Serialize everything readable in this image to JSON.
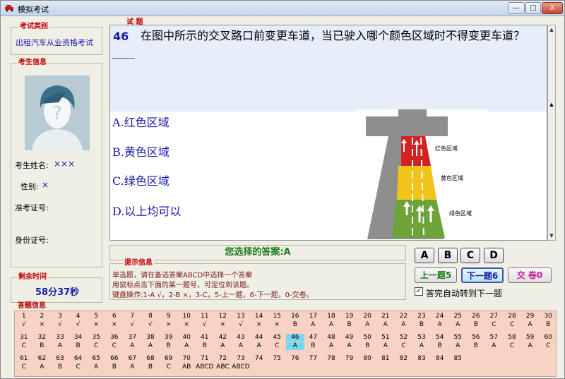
{
  "window": {
    "title": "模拟考试",
    "minimize": "—",
    "maximize": "□",
    "close": "X"
  },
  "exam_type": {
    "label": "考试类别",
    "value": "出租汽车从业资格考试"
  },
  "examinee": {
    "label": "考生信息",
    "name_label": "考生姓名:",
    "name_value": "×××",
    "gender_label": "性别:",
    "gender_value": "×",
    "ticket_label": "准考证号:",
    "id_label": "身份证号:"
  },
  "timer": {
    "label": "剩余时间",
    "value": "58分37秒"
  },
  "question": {
    "label": "试 题",
    "number": "46",
    "text": "在图中所示的交叉路口前变更车道，当已驶入哪个颜色区域时不得变更车道？____",
    "options": [
      "A.红色区域",
      "B.黄色区域",
      "C.绿色区域",
      "D.以上均可以"
    ],
    "figure_labels": [
      "红色区域",
      "黄色区域",
      "绿色区域"
    ]
  },
  "selected_answer": {
    "text": "您选择的答案:A"
  },
  "hints": {
    "label": "提示信息",
    "lines": [
      "单选题，请在备选答案ABCD中选择一个答案",
      "用鼠标点击下面的某一题号，可定位到该题。",
      "键盘操作:1-A √，2-B ×，3-C，5-上一题，6-下一题，0-交卷。"
    ]
  },
  "answer_buttons": [
    "A",
    "B",
    "C",
    "D"
  ],
  "nav": {
    "prev": "上一题5",
    "next": "下一题6",
    "submit": "交 卷0"
  },
  "auto_next": {
    "label": "答完自动转到下一题",
    "checked": "✓"
  },
  "answer_grid": {
    "label": "答题信息",
    "rows": [
      {
        "nums": [
          "1",
          "2",
          "3",
          "4",
          "5",
          "6",
          "7",
          "8",
          "9",
          "10",
          "11",
          "12",
          "13",
          "14",
          "15",
          "16",
          "17",
          "18",
          "19",
          "20",
          "21",
          "22",
          "23",
          "24",
          "25",
          "26",
          "27",
          "28",
          "29",
          "30"
        ],
        "answers": [
          "√",
          "×",
          "√",
          "√",
          "×",
          "×",
          "√",
          "√",
          "×",
          "×",
          "√",
          "×",
          "√",
          "×",
          "×",
          "B",
          "A",
          "A",
          "B",
          "A",
          "A",
          "A",
          "B",
          "A",
          "A",
          "B",
          "C",
          "C",
          "A",
          "B"
        ]
      },
      {
        "nums": [
          "31",
          "32",
          "33",
          "34",
          "35",
          "36",
          "37",
          "38",
          "39",
          "40",
          "41",
          "42",
          "43",
          "44",
          "45",
          "46",
          "47",
          "48",
          "49",
          "50",
          "51",
          "52",
          "53",
          "54",
          "55",
          "56",
          "57",
          "58",
          "59",
          "60"
        ],
        "answers": [
          "C",
          "B",
          "A",
          "B",
          "C",
          "C",
          "A",
          "A",
          "B",
          "A",
          "B",
          "A",
          "A",
          "A",
          "C",
          "A",
          "B",
          "A",
          "A",
          "B",
          "A",
          "C",
          "A",
          "B",
          "A",
          "B",
          "A",
          "C",
          "A",
          "C"
        ]
      },
      {
        "nums": [
          "61",
          "62",
          "63",
          "64",
          "65",
          "66",
          "67",
          "68",
          "69",
          "70",
          "71",
          "72",
          "73",
          "74",
          "75",
          "76",
          "77",
          "78",
          "79",
          "80",
          "81",
          "82",
          "83",
          "84",
          "85"
        ],
        "answers": [
          "C",
          "A",
          "B",
          "C",
          "A",
          "B",
          "A",
          "B",
          "C",
          "AB",
          "ABCD",
          "ABC",
          "ABCD",
          "",
          "",
          "",
          "",
          "",
          "",
          "",
          "",
          "",
          "",
          "",
          ""
        ]
      }
    ],
    "current": "46"
  },
  "colors": {
    "title_red": "#c00000",
    "option_blue": "#1a1aa8",
    "answer_green": "#1f7a1f",
    "grid_bg": "#f8d2c2",
    "highlight": "#7ad7ef"
  }
}
